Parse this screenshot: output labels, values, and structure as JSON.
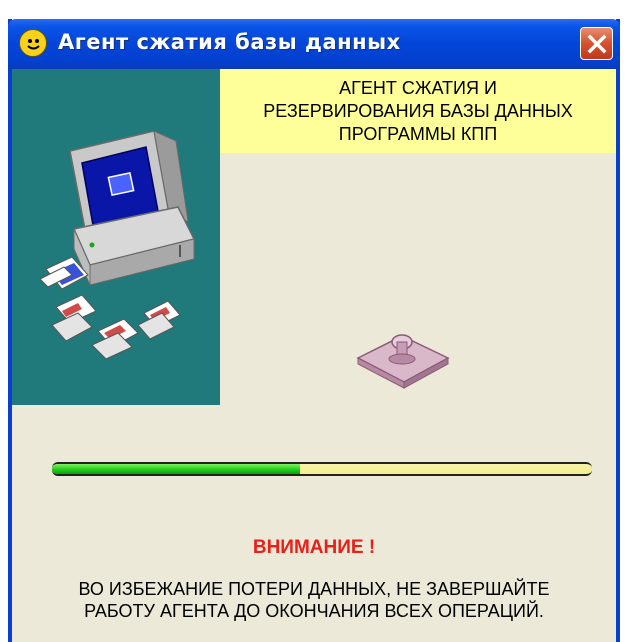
{
  "window": {
    "title": "Агент сжатия базы данных",
    "title_icon": "smiley-icon",
    "close_icon": "close-icon"
  },
  "header": {
    "lines": [
      "АГЕНТ СЖАТИЯ И",
      "РЕЗЕРВИРОВАНИЯ  БАЗЫ ДАННЫХ",
      "ПРОГРАММЫ КПП"
    ]
  },
  "illustration": {
    "icon": "computer-with-documents-icon",
    "stamp_icon": "stamp-icon"
  },
  "progress": {
    "fraction": 0.46
  },
  "warning": {
    "title": "ВНИМАНИЕ !",
    "lines": [
      "ВО ИЗБЕЖАНИЕ ПОТЕРИ ДАННЫХ,  НЕ ЗАВЕРШАЙТЕ",
      "РАБОТУ АГЕНТА ДО ОКОНЧАНИЯ ВСЕХ ОПЕРАЦИЙ."
    ]
  },
  "colors": {
    "titlebar": "#0445d8",
    "panel": "#207a7c",
    "header_bg": "#ffff99",
    "progress_fill": "#1ec81a",
    "warning": "#e8201a"
  }
}
